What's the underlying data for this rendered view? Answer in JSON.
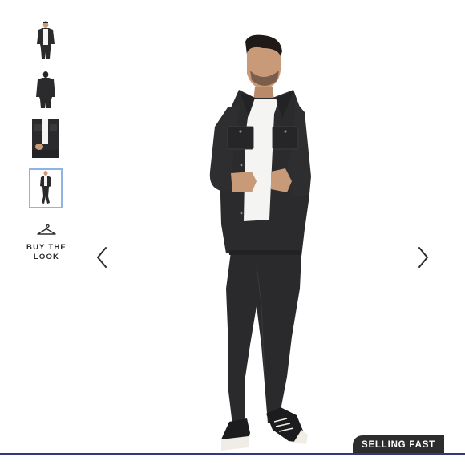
{
  "gallery": {
    "thumbnails": [
      {
        "label": "front view",
        "selected": false
      },
      {
        "label": "back view",
        "selected": false
      },
      {
        "label": "detail view",
        "selected": false
      },
      {
        "label": "full length view",
        "selected": true
      }
    ],
    "buy_the_look": {
      "label": "BUY THE\nLOOK",
      "icon": "hanger-icon"
    },
    "prev_arrow_icon": "chevron-left-icon",
    "next_arrow_icon": "chevron-right-icon",
    "badge": {
      "label": "SELLING FAST"
    }
  },
  "colors": {
    "selected_thumb_border": "#8fb3e3",
    "badge_bg": "#2d2d2d",
    "badge_text": "#ffffff",
    "bottom_bar": "#2e3a7a",
    "jacket": "#2b2b2d",
    "jeans": "#2a2a2c",
    "tshirt": "#f4f4f2",
    "skin": "#c89a78"
  }
}
